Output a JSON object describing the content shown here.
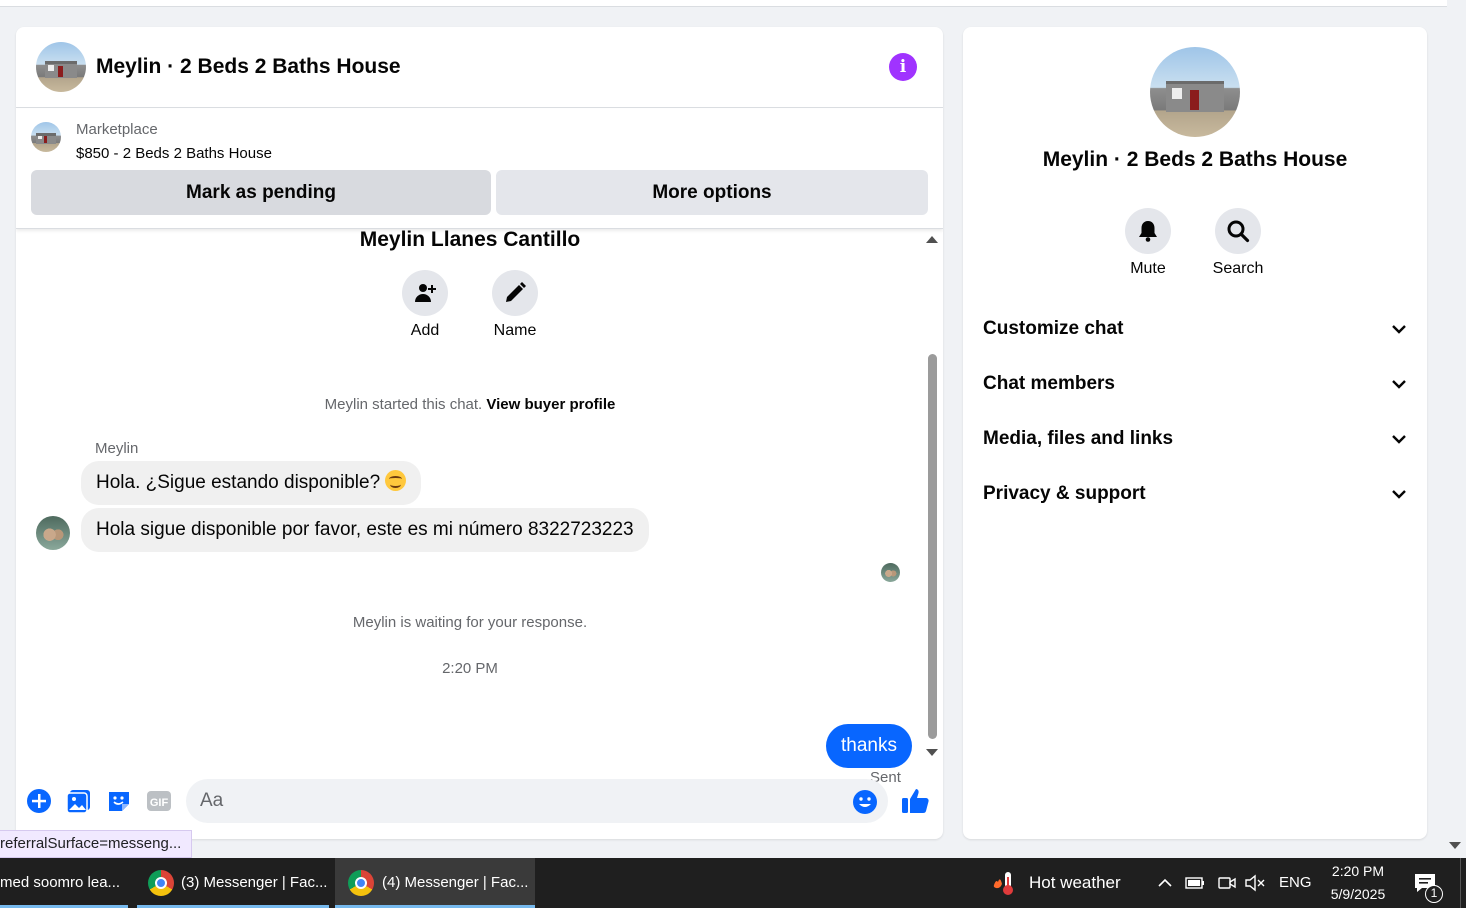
{
  "chat": {
    "title": "Meylin · 2 Beds 2 Baths House",
    "info_icon": "info-icon",
    "marketplace": {
      "label": "Marketplace",
      "item": "$850 - 2 Beds 2 Baths House",
      "mark_pending": "Mark as pending",
      "more_options": "More options"
    },
    "contact_name": "Meylin Llanes Cantillo",
    "actions": [
      {
        "label": "Add",
        "icon": "add-person-icon"
      },
      {
        "label": "Name",
        "icon": "pencil-icon"
      }
    ],
    "started_text": "Meylin started this chat.",
    "buyer_profile_link": "View buyer profile",
    "sender_name": "Meylin",
    "messages_in": [
      "Hola. ¿Sigue estando disponible?",
      "Hola sigue disponible por favor, este es mi número 8322723223"
    ],
    "waiting_text": "Meylin is waiting for your response.",
    "timestamp": "2:20 PM",
    "message_out": "thanks",
    "sent_status": "Sent",
    "composer": {
      "placeholder": "Aa"
    },
    "status_tooltip": "referralSurface=messeng..."
  },
  "info_panel": {
    "name": "Meylin · 2 Beds 2 Baths House",
    "actions": [
      {
        "label": "Mute",
        "icon": "bell-icon"
      },
      {
        "label": "Search",
        "icon": "search-icon"
      }
    ],
    "sections": [
      "Customize chat",
      "Chat members",
      "Media, files and links",
      "Privacy & support"
    ]
  },
  "taskbar": {
    "items": [
      "med soomro lea...",
      "(3) Messenger | Fac...",
      "(4) Messenger | Fac..."
    ],
    "weather": "Hot weather",
    "language": "ENG",
    "time": "2:20 PM",
    "date": "5/9/2025",
    "notification_count": "1"
  },
  "colors": {
    "accent": "#0866ff",
    "info_purple": "#a033ff",
    "taskbar": "#1f1f1f"
  }
}
